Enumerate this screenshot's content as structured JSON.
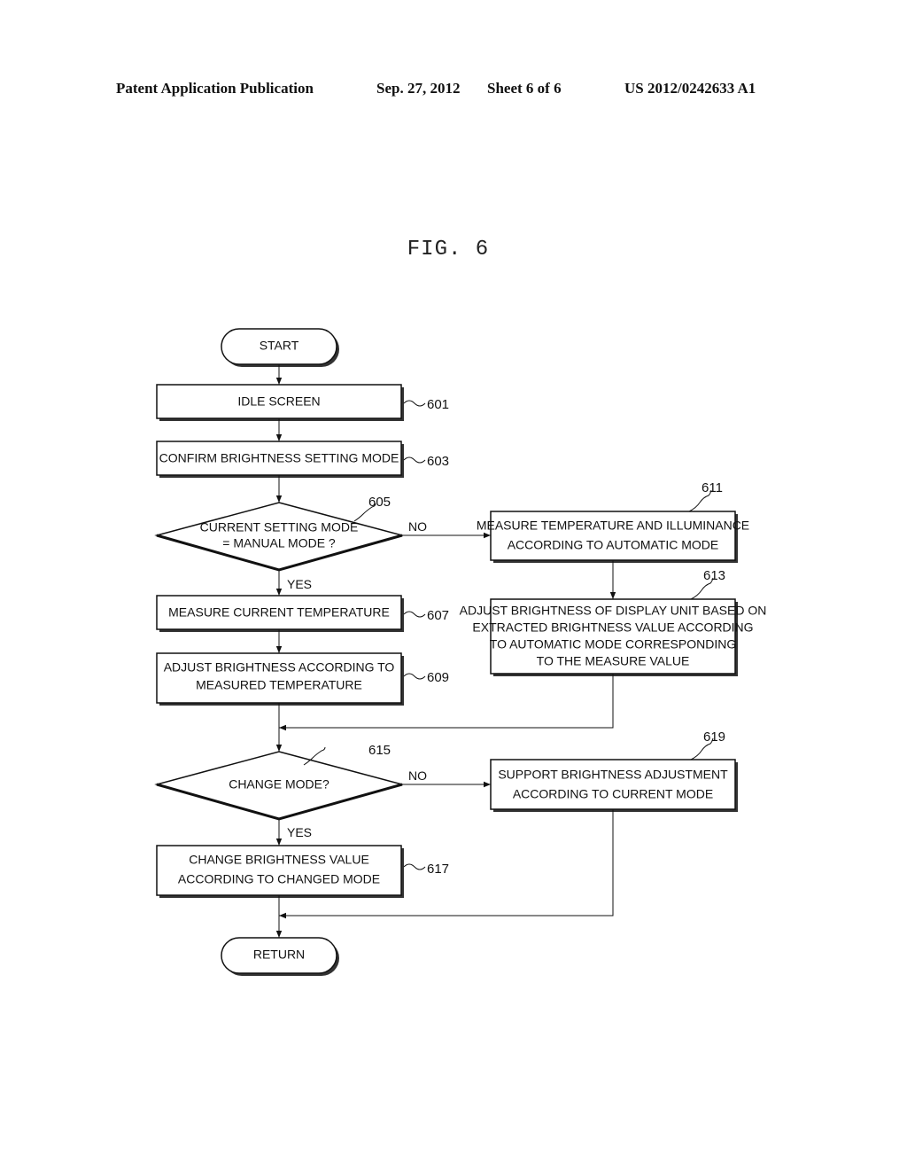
{
  "header": {
    "publication": "Patent Application Publication",
    "date": "Sep. 27, 2012",
    "sheet": "Sheet 6 of 6",
    "patent_number": "US 2012/0242633 A1"
  },
  "figure": {
    "title": "FIG. 6"
  },
  "flowchart": {
    "start": "START",
    "end": "RETURN",
    "steps": {
      "s601": {
        "ref": "601",
        "lines": [
          "IDLE SCREEN"
        ]
      },
      "s603": {
        "ref": "603",
        "lines": [
          "CONFIRM BRIGHTNESS SETTING MODE"
        ]
      },
      "s605": {
        "ref": "605",
        "lines": [
          "CURRENT SETTING MODE",
          "= MANUAL MODE ?"
        ]
      },
      "s607": {
        "ref": "607",
        "lines": [
          "MEASURE CURRENT TEMPERATURE"
        ]
      },
      "s609": {
        "ref": "609",
        "lines": [
          "ADJUST BRIGHTNESS ACCORDING TO",
          "MEASURED TEMPERATURE"
        ]
      },
      "s611": {
        "ref": "611",
        "lines": [
          "MEASURE TEMPERATURE AND ILLUMINANCE",
          "ACCORDING TO AUTOMATIC MODE"
        ]
      },
      "s613": {
        "ref": "613",
        "lines": [
          "ADJUST BRIGHTNESS OF DISPLAY UNIT BASED ON",
          "EXTRACTED BRIGHTNESS VALUE ACCORDING",
          "TO AUTOMATIC MODE CORRESPONDING",
          "TO THE MEASURE VALUE"
        ]
      },
      "s615": {
        "ref": "615",
        "lines": [
          "CHANGE MODE?"
        ]
      },
      "s617": {
        "ref": "617",
        "lines": [
          "CHANGE BRIGHTNESS VALUE",
          "ACCORDING TO CHANGED MODE"
        ]
      },
      "s619": {
        "ref": "619",
        "lines": [
          "SUPPORT BRIGHTNESS ADJUSTMENT",
          "ACCORDING TO CURRENT MODE"
        ]
      }
    },
    "branch_labels": {
      "yes": "YES",
      "no": "NO"
    }
  }
}
